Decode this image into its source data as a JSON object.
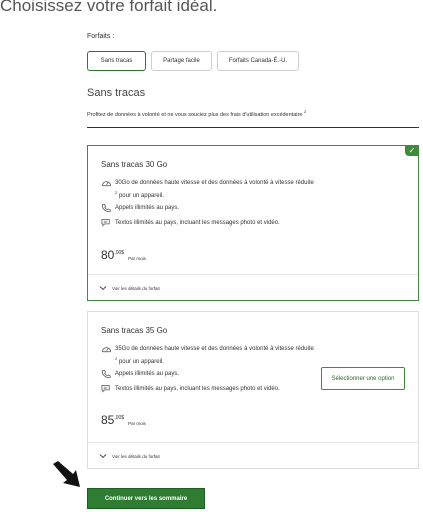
{
  "header": {
    "title": "Choisissez votre forfait idéal."
  },
  "forfaits": {
    "label": "Forfaits :",
    "tabs": [
      {
        "label": "Sans tracas",
        "active": true
      },
      {
        "label": "Partage facile",
        "active": false
      },
      {
        "label": "Forfaits Canada-É.-U.",
        "active": false
      }
    ]
  },
  "section": {
    "title": "Sans tracas",
    "description": "Profitez de données à volonté et ne vous souciez plus des frais d'utilisation excédentaire",
    "description_note": "2"
  },
  "plans": [
    {
      "name": "Sans tracas 30 Go",
      "selected": true,
      "features": [
        {
          "icon": "speed-gauge-icon",
          "text": "30Go de données haute vitesse et des données à volonté à vitesse réduite",
          "note": "2",
          "text_after": "pour un appareil."
        },
        {
          "icon": "phone-icon",
          "text": "Appels illimités au pays."
        },
        {
          "icon": "chat-bubble-icon",
          "text": "Textos illimités au pays, incluant les messages photo et vidéo."
        }
      ],
      "price": {
        "dollars": "80",
        "cents": ",00$",
        "period": "Par mois"
      },
      "details_label": "Voir les détails du forfait"
    },
    {
      "name": "Sans tracas 35 Go",
      "selected": false,
      "features": [
        {
          "icon": "speed-gauge-icon",
          "text": "35Go de données haute vitesse et des données à volonté à vitesse réduite",
          "note": "2",
          "text_after": "pour un appareil."
        },
        {
          "icon": "phone-icon",
          "text": "Appels illimités au pays."
        },
        {
          "icon": "chat-bubble-icon",
          "text": "Textos illimités au pays, incluant les messages photo et vidéo."
        }
      ],
      "price": {
        "dollars": "85",
        "cents": ",00$",
        "period": "Par mois"
      },
      "select_label": "Sélectionner une option",
      "details_label": "Voir les détails du forfait"
    }
  ],
  "actions": {
    "continue_label": "Continuer vers les sommaire"
  },
  "colors": {
    "accent_green": "#2e7d32",
    "selected_border": "#3f8a3f",
    "text": "#333333"
  }
}
